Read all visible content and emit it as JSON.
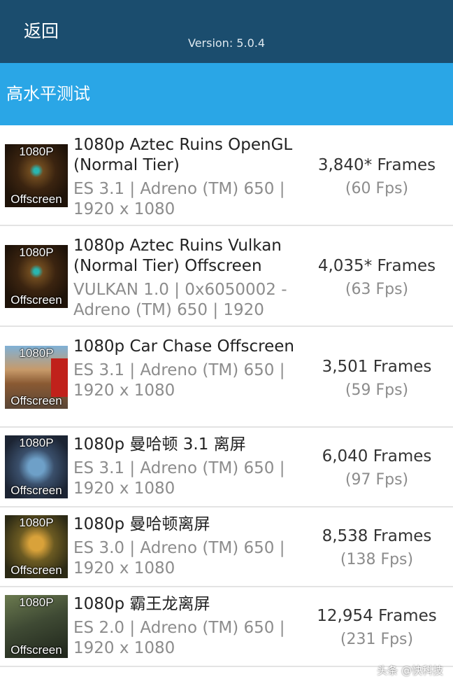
{
  "header": {
    "back_label": "返回",
    "version": "Version: 5.0.4"
  },
  "section": {
    "title": "高水平测试"
  },
  "tests": [
    {
      "thumb_top": "1080P",
      "thumb_bottom": "Offscreen",
      "name": "1080p Aztec Ruins OpenGL (Normal Tier)",
      "spec": "ES 3.1 | Adreno (TM) 650 | 1920 x 1080",
      "frames": "3,840* Frames",
      "fps": "(60 Fps)"
    },
    {
      "thumb_top": "1080P",
      "thumb_bottom": "Offscreen",
      "name": "1080p Aztec Ruins Vulkan (Normal Tier) Offscreen",
      "spec": "VULKAN 1.0 | 0x6050002 - Adreno (TM) 650 | 1920",
      "frames": "4,035* Frames",
      "fps": "(63 Fps)"
    },
    {
      "thumb_top": "1080P",
      "thumb_bottom": "Offscreen",
      "name": "1080p Car Chase Offscreen",
      "spec": "ES 3.1 | Adreno (TM) 650 | 1920 x 1080",
      "frames": "3,501 Frames",
      "fps": "(59 Fps)"
    },
    {
      "thumb_top": "1080P",
      "thumb_bottom": "Offscreen",
      "name": "1080p 曼哈顿 3.1 离屏",
      "spec": "ES 3.1 | Adreno (TM) 650 | 1920 x 1080",
      "frames": "6,040 Frames",
      "fps": "(97 Fps)"
    },
    {
      "thumb_top": "1080P",
      "thumb_bottom": "Offscreen",
      "name": "1080p 曼哈顿离屏",
      "spec": "ES 3.0 | Adreno (TM) 650 | 1920 x 1080",
      "frames": "8,538 Frames",
      "fps": "(138 Fps)"
    },
    {
      "thumb_top": "1080P",
      "thumb_bottom": "Offscreen",
      "name": "1080p 霸王龙离屏",
      "spec": "ES 2.0 | Adreno (TM) 650 | 1920 x 1080",
      "frames": "12,954 Frames",
      "fps": "(231 Fps)"
    }
  ],
  "watermark": "头条 @快科技",
  "colors": {
    "header_bg": "#1b4d6e",
    "section_bg": "#2aa6e6"
  }
}
